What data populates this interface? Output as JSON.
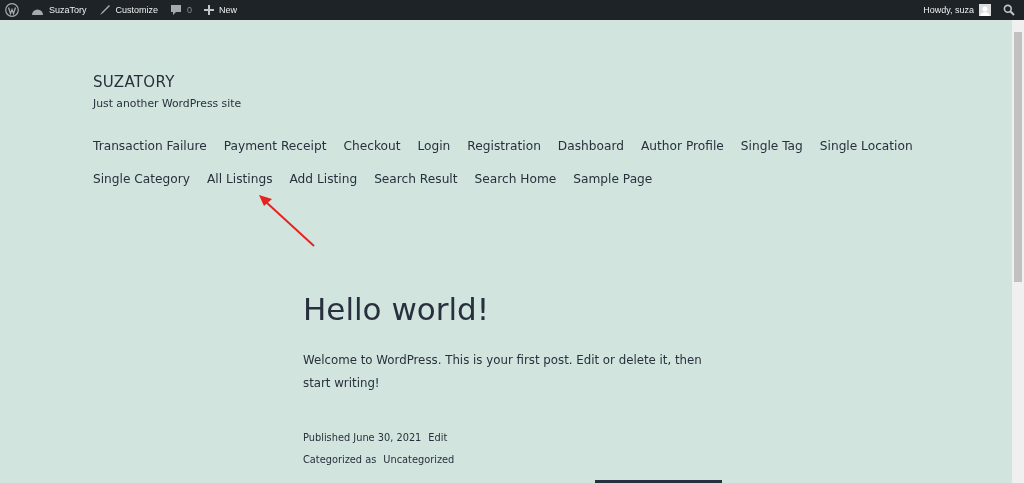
{
  "admin_bar": {
    "site": "SuzaTory",
    "customize": "Customize",
    "comments": "0",
    "new": "New",
    "greeting": "Howdy, suza"
  },
  "site": {
    "title": "SUZATORY",
    "tagline": "Just another WordPress site"
  },
  "menu": [
    "Transaction Failure",
    "Payment Receipt",
    "Checkout",
    "Login",
    "Registration",
    "Dashboard",
    "Author Profile",
    "Single Tag",
    "Single Location",
    "Single Category",
    "All Listings",
    "Add Listing",
    "Search Result",
    "Search Home",
    "Sample Page"
  ],
  "post": {
    "title": "Hello world!",
    "body": "Welcome to WordPress. This is your first post. Edit or delete it, then start writing!",
    "published": "Published June 30, 2021",
    "edit": "Edit",
    "categorized": "Categorized as",
    "category": "Uncategorized"
  }
}
